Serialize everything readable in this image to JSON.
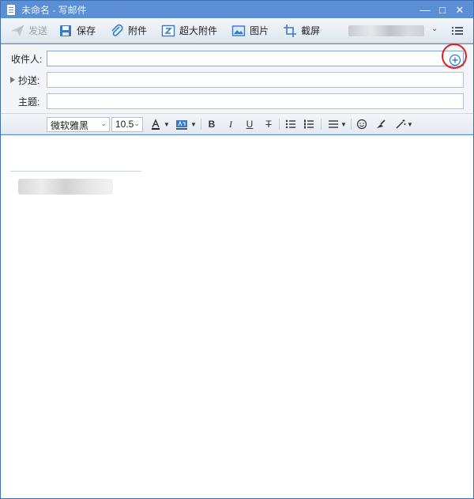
{
  "window": {
    "title": "未命名 - 写邮件",
    "controls": {
      "minimize": "—",
      "maximize": "□",
      "close": "✕"
    }
  },
  "toolbar": {
    "send_label": "发送",
    "save_label": "保存",
    "attach_label": "附件",
    "big_attach_label": "超大附件",
    "image_label": "图片",
    "screenshot_label": "截屏",
    "account_dropdown_caret": "⌄"
  },
  "fields": {
    "to_label": "收件人:",
    "to_value": "",
    "cc_label": "抄送:",
    "cc_value": "",
    "subject_label": "主题:",
    "subject_value": ""
  },
  "format": {
    "font_family": "微软雅黑",
    "font_size": "10.5",
    "bold": "B",
    "italic": "I",
    "underline": "U",
    "strike": "T"
  },
  "colors": {
    "titlebar": "#5a8fd6",
    "accent": "#2f7fd1",
    "highlight_circle": "#e02020"
  },
  "icons": [
    "send-icon",
    "save-icon",
    "paperclip-icon",
    "big-attachment-icon",
    "image-icon",
    "screenshot-icon",
    "menu-icon",
    "add-recipient-icon"
  ]
}
